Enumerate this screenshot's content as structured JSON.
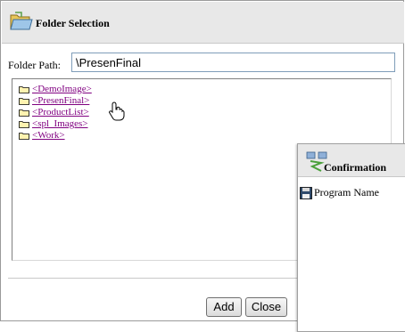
{
  "dialog": {
    "title": "Folder Selection",
    "folder_path_label": "Folder Path:",
    "folder_path_value": "\\PresenFinal"
  },
  "tree": {
    "items": [
      {
        "label": "<DemoImage>"
      },
      {
        "label": "<PresenFinal>"
      },
      {
        "label": "<ProductList>"
      },
      {
        "label": "<spl_Images>"
      },
      {
        "label": "<Work>"
      }
    ]
  },
  "buttons": {
    "add": "Add",
    "close": "Close"
  },
  "confirmation": {
    "title": "Confirmation",
    "program_name_label": "Program Name"
  },
  "icons": {
    "title_icon": "folder-open-icon",
    "tree_item_icon": "folder-icon",
    "cursor_icon": "hand-pointer-icon",
    "confirm_icon": "confirmation-transfer-icon",
    "disk_icon": "floppy-disk-icon"
  },
  "colors": {
    "link_visited": "#800080",
    "header_bg": "#e8e8e8"
  }
}
